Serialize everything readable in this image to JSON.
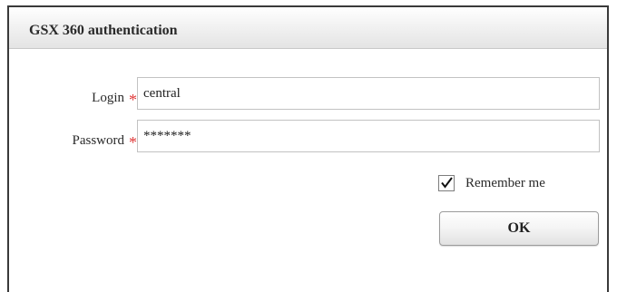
{
  "dialog": {
    "title": "GSX 360 authentication"
  },
  "form": {
    "login": {
      "label": "Login",
      "required_marker": "*",
      "value": "central"
    },
    "password": {
      "label": "Password",
      "required_marker": "*",
      "value": "*******"
    },
    "remember": {
      "label": "Remember me",
      "checked": true,
      "icon": "checkmark-icon"
    },
    "ok_label": "OK"
  },
  "colors": {
    "required_marker": "#e03a3a",
    "title_bar": "#e4e4e4"
  }
}
